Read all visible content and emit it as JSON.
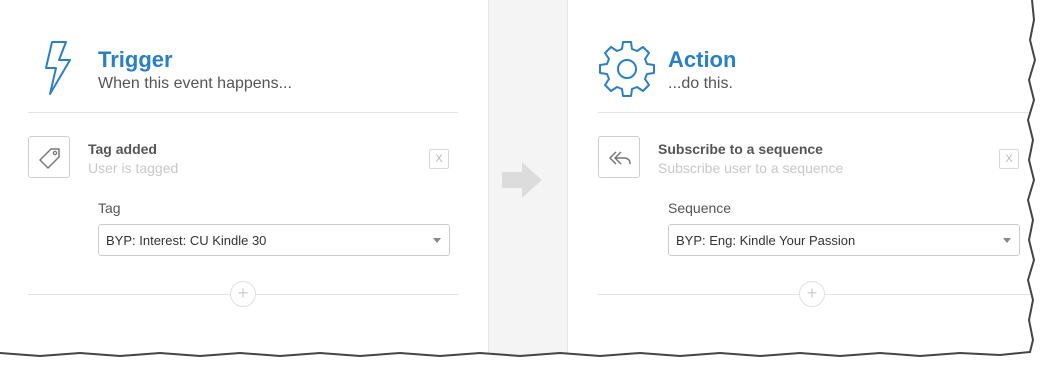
{
  "trigger": {
    "header_icon": "lightning-icon",
    "title": "Trigger",
    "subtitle": "When this event happens...",
    "step": {
      "icon": "tag-icon",
      "title": "Tag added",
      "subtitle": "User is tagged",
      "close_label": "X"
    },
    "field": {
      "label": "Tag",
      "value": "BYP: Interest: CU Kindle 30"
    },
    "add_label": "+"
  },
  "action": {
    "header_icon": "gear-icon",
    "title": "Action",
    "subtitle": "...do this.",
    "step": {
      "icon": "reply-all-icon",
      "title": "Subscribe to a sequence",
      "subtitle": "Subscribe user to a sequence",
      "close_label": "X"
    },
    "field": {
      "label": "Sequence",
      "value": "BYP: Eng: Kindle Your Passion"
    },
    "add_label": "+"
  },
  "colors": {
    "accent": "#2a7fc5",
    "divider_bg": "#f4f4f4",
    "arrow": "#dcdcdc"
  }
}
